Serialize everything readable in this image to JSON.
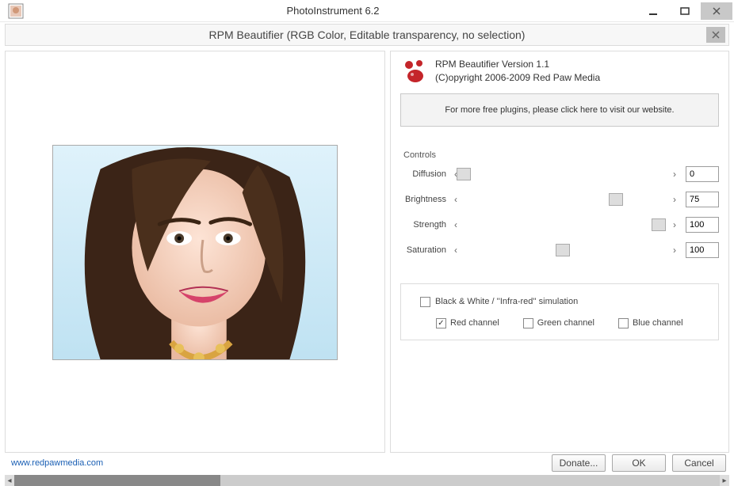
{
  "window": {
    "title": "PhotoInstrument 6.2"
  },
  "dialog": {
    "title": "RPM Beautifier (RGB Color, Editable transparency, no selection)"
  },
  "plugin": {
    "name_line": "RPM Beautifier   Version 1.1",
    "copyright": "(C)opyright 2006-2009 Red Paw Media",
    "info_box": "For more free plugins, please click here to visit our website."
  },
  "controls": {
    "legend": "Controls",
    "items": [
      {
        "label": "Diffusion",
        "value": "0",
        "thumb_pct": 0
      },
      {
        "label": "Brightness",
        "value": "75",
        "thumb_pct": 75
      },
      {
        "label": "Strength",
        "value": "100",
        "thumb_pct": 96
      },
      {
        "label": "Saturation",
        "value": "100",
        "thumb_pct": 49
      }
    ]
  },
  "bw": {
    "main_label": "Black & White / ''Infra-red'' simulation",
    "main_checked": false,
    "channels": [
      {
        "label": "Red channel",
        "checked": true
      },
      {
        "label": "Green channel",
        "checked": false
      },
      {
        "label": "Blue channel",
        "checked": false
      }
    ]
  },
  "footer": {
    "website": "www.redpawmedia.com",
    "donate": "Donate...",
    "ok": "OK",
    "cancel": "Cancel"
  }
}
